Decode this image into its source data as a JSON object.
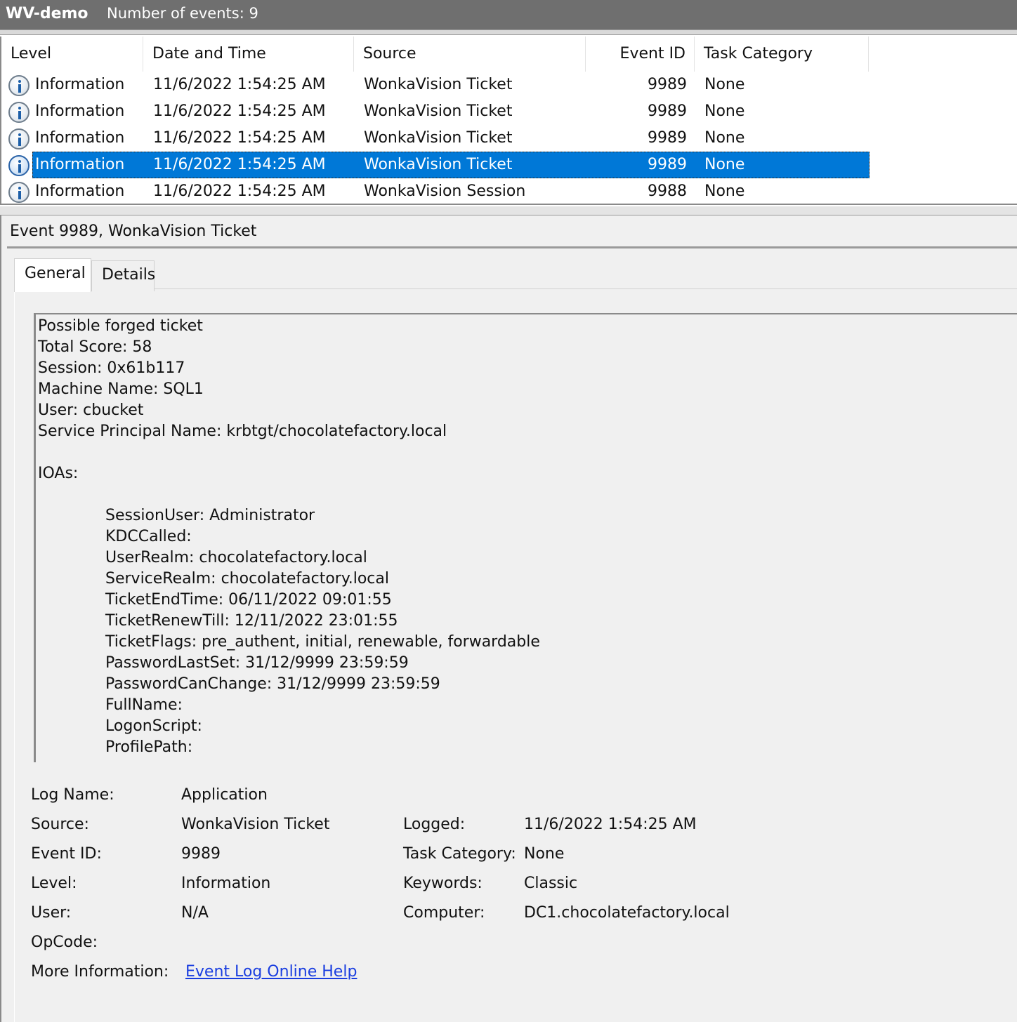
{
  "titlebar": {
    "name": "WV-demo",
    "count_text": "Number of events: 9"
  },
  "columns": {
    "level": "Level",
    "date_time": "Date and Time",
    "source": "Source",
    "event_id": "Event ID",
    "task_category": "Task Category"
  },
  "rows": [
    {
      "icon": "info-icon",
      "level": "Information",
      "date_time": "11/6/2022 1:54:25 AM",
      "source": "WonkaVision Ticket",
      "event_id": "9989",
      "task_category": "None",
      "selected": false
    },
    {
      "icon": "info-icon",
      "level": "Information",
      "date_time": "11/6/2022 1:54:25 AM",
      "source": "WonkaVision Ticket",
      "event_id": "9989",
      "task_category": "None",
      "selected": false
    },
    {
      "icon": "info-icon",
      "level": "Information",
      "date_time": "11/6/2022 1:54:25 AM",
      "source": "WonkaVision Ticket",
      "event_id": "9989",
      "task_category": "None",
      "selected": false
    },
    {
      "icon": "info-icon",
      "level": "Information",
      "date_time": "11/6/2022 1:54:25 AM",
      "source": "WonkaVision Ticket",
      "event_id": "9989",
      "task_category": "None",
      "selected": true
    },
    {
      "icon": "info-icon",
      "level": "Information",
      "date_time": "11/6/2022 1:54:25 AM",
      "source": "WonkaVision Session",
      "event_id": "9988",
      "task_category": "None",
      "selected": false
    }
  ],
  "selection_color": "#0078d7",
  "detail": {
    "header": "Event 9989, WonkaVision Ticket",
    "tabs": {
      "general": "General",
      "details": "Details"
    },
    "message": {
      "line1": "Possible forged ticket",
      "line2": "Total Score: 58",
      "line3": "Session: 0x61b117",
      "line4": "Machine Name: SQL1",
      "line5": "User: cbucket",
      "line6": "Service Principal Name: krbtgt/chocolatefactory.local",
      "ioas_header": "IOAs:",
      "ioas": [
        "SessionUser: Administrator",
        "KDCCalled:",
        "UserRealm: chocolatefactory.local",
        "ServiceRealm: chocolatefactory.local",
        "TicketEndTime: 06/11/2022 09:01:55",
        "TicketRenewTill: 12/11/2022 23:01:55",
        "TicketFlags: pre_authent, initial, renewable, forwardable",
        "PasswordLastSet: 31/12/9999 23:59:59",
        "PasswordCanChange: 31/12/9999 23:59:59",
        "FullName:",
        "LogonScript:",
        "ProfilePath:"
      ]
    },
    "meta": {
      "log_name_label": "Log Name:",
      "log_name": "Application",
      "source_label": "Source:",
      "source": "WonkaVision Ticket",
      "logged_label": "Logged:",
      "logged": "11/6/2022 1:54:25 AM",
      "event_id_label": "Event ID:",
      "event_id": "9989",
      "task_category_label": "Task Category:",
      "task_category": "None",
      "level_label": "Level:",
      "level": "Information",
      "keywords_label": "Keywords:",
      "keywords": "Classic",
      "user_label": "User:",
      "user": "N/A",
      "computer_label": "Computer:",
      "computer": "DC1.chocolatefactory.local",
      "opcode_label": "OpCode:",
      "more_info_label": "More Information:",
      "more_info_link": "Event Log Online Help"
    }
  }
}
